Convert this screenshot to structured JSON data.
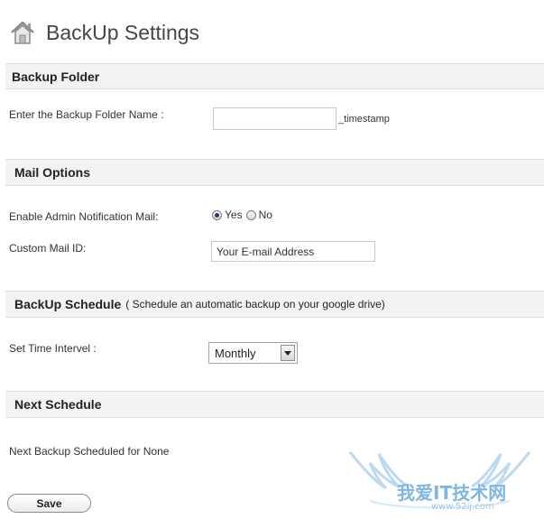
{
  "header": {
    "title": "BackUp Settings",
    "icon": "home-icon"
  },
  "backup_folder": {
    "heading": "Backup Folder",
    "label": "Enter the Backup Folder Name :",
    "value": "",
    "placeholder": "",
    "suffix": "_timestamp"
  },
  "mail_options": {
    "heading": "Mail Options",
    "notify_label": "Enable Admin Notification Mail:",
    "yes_label": "Yes",
    "no_label": "No",
    "selected": "Yes",
    "mail_label": "Custom Mail ID:",
    "mail_value": "Your E-mail Address"
  },
  "schedule": {
    "heading": "BackUp Schedule",
    "subheading": "( Schedule an automatic backup on your google drive)",
    "interval_label": "Set Time Intervel :",
    "interval_value": "Monthly"
  },
  "next_schedule": {
    "heading": "Next Schedule",
    "text": "Next Backup Scheduled for None"
  },
  "actions": {
    "save_label": "Save"
  },
  "watermark": {
    "text": "我爱IT技术网",
    "url": "www.52ij.com"
  },
  "colors": {
    "section_bg": "#f3f3f3",
    "section_border": "#dfdfdf",
    "radio_selected": "#1b3c6e",
    "watermark": "#7fb6e3"
  }
}
